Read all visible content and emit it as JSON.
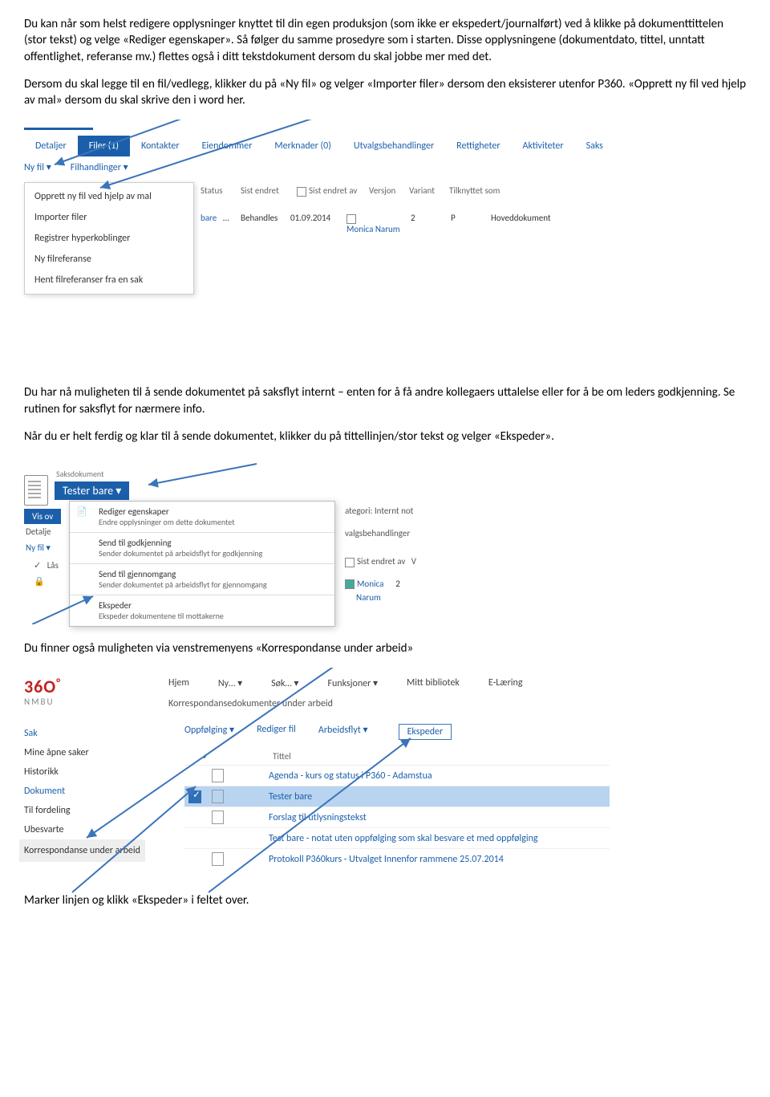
{
  "paras": {
    "p1": "Du kan når som helst redigere opplysninger knyttet til din egen produksjon (som ikke er ekspedert/journalført) ved å klikke på dokumenttittelen (stor tekst) og velge «Rediger egenskaper». Så følger du samme prosedyre som i starten. Disse opplysningene (dokumentdato, tittel, unntatt offentlighet, referanse mv.) flettes også i ditt tekstdokument dersom du skal jobbe mer med det.",
    "p2": "Dersom du skal legge til en fil/vedlegg, klikker du på «Ny fil» og velger «Importer filer» dersom den eksisterer utenfor P360. «Opprett ny fil ved hjelp av mal» dersom du skal skrive den i word her.",
    "p3": "Du har nå muligheten til å sende dokumentet på saksflyt internt – enten for å få andre kollegaers uttalelse eller for å be om leders godkjenning. Se rutinen for saksflyt for nærmere info.",
    "p4": "Når du er helt ferdig og klar til å sende dokumentet, klikker du på tittellinjen/stor tekst og velger «Ekspeder».",
    "p5": "Du finner også muligheten via venstremenyens «Korrespondanse under arbeid»",
    "p6": "Marker linjen og klikk «Ekspeder» i feltet over."
  },
  "shot1": {
    "tabs": [
      "Detaljer",
      "Filer (1)",
      "Kontakter",
      "Eiendommer",
      "Merknader (0)",
      "Utvalgsbehandlinger",
      "Rettigheter",
      "Aktiviteter",
      "Saks"
    ],
    "row2a": "Ny fil ▾",
    "row2b": "Filhandlinger ▾",
    "dd": [
      "Opprett ny fil ved hjelp av mal",
      "Importer filer",
      "Registrer hyperkoblinger",
      "Ny filreferanse",
      "Hent filreferanser fra en sak"
    ],
    "th": {
      "bare": "bare",
      "ell": "…",
      "status": "Status",
      "se": "Sist endret",
      "seav": "Sist endret av",
      "ver": "Versjon",
      "var": "Variant",
      "tk": "Tilknyttet som"
    },
    "td": {
      "beh": "Behandles",
      "dato": "01.09.2014",
      "mn": "Monica Narum",
      "ver": "2",
      "var": "P",
      "tk": "Hoveddokument"
    }
  },
  "shot2": {
    "saks": "Saksdokument",
    "title": "Tester bare ▾",
    "vis": "Vis ov",
    "det": "Detalje",
    "nyfil": "Ny fil ▾",
    "menu": [
      {
        "t": "Rediger egenskaper",
        "s": "Endre opplysninger om dette dokumentet"
      },
      {
        "t": "Send til godkjenning",
        "s": "Sender dokumentet på arbeidsflyt for godkjenning"
      },
      {
        "t": "Send til gjennomgang",
        "s": "Sender dokumentet på arbeidsflyt for gjennomgang"
      },
      {
        "t": "Ekspeder",
        "s": "Ekspeder dokumentene til mottakerne"
      }
    ],
    "kat": "ategori: Internt not",
    "valg": "valgsbehandlinger",
    "seav": "Sist endret av",
    "v": "V",
    "mn": "Monica",
    "nar": "Narum",
    "two": "2",
    "las": "Lås"
  },
  "shot3": {
    "logo": "36O",
    "nmbu": "NMBU",
    "nav": [
      "Hjem",
      "Ny…   ▾",
      "Søk…   ▾",
      "Funksjoner   ▾",
      "Mitt bibliotek",
      "E-Læring"
    ],
    "bc": "Korrespondansedokumenter under arbeid",
    "left": {
      "sak": "Sak",
      "m1": "Mine åpne saker",
      "m2": "Historikk",
      "dok": "Dokument",
      "m3": "Til fordeling",
      "m4": "Ubesvarte",
      "m5": "Korrespondanse under arbeid"
    },
    "actions": {
      "opp": "Oppfølging ▾",
      "red": "Rediger fil",
      "arb": "Arbeidsflyt ▾",
      "eks": "Ekspeder"
    },
    "tittel": "Tittel",
    "rows": [
      "Agenda - kurs og status i P360 - Adamstua",
      "Tester bare",
      "Forslag til utlysningstekst",
      "Test bare - notat uten oppfølging som skal besvare et med oppfølging",
      "Protokoll P360kurs - Utvalget Innenfor rammene 25.07.2014"
    ]
  }
}
